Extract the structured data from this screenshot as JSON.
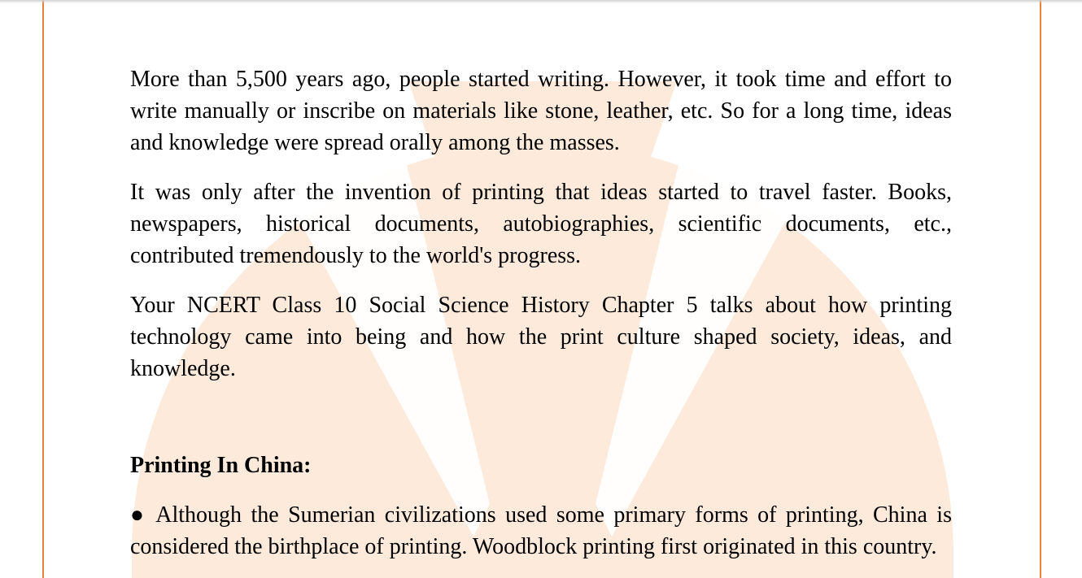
{
  "document": {
    "paragraphs": [
      "More than 5,500 years ago, people started writing. However, it took time and effort to write manually or inscribe on materials like stone, leather, etc. So for a long time, ideas and knowledge were spread orally among the masses.",
      "It was only after the invention of printing that ideas started to travel faster. Books, newspapers, historical documents, autobiographies, scientific documents, etc., contributed tremendously to the world's progress.",
      "Your NCERT Class 10 Social Science History Chapter 5 talks about how printing technology came into being and how the print culture shaped society, ideas, and knowledge."
    ],
    "heading": "Printing In China:",
    "bullets": [
      {
        "marker": "●",
        "text": "Although the Sumerian civilizations used some primary forms of printing, China is considered the birthplace of printing. Woodblock printing first originated in this country."
      }
    ]
  },
  "colors": {
    "page_border": "#e8833a",
    "watermark": "#fde7d3"
  }
}
